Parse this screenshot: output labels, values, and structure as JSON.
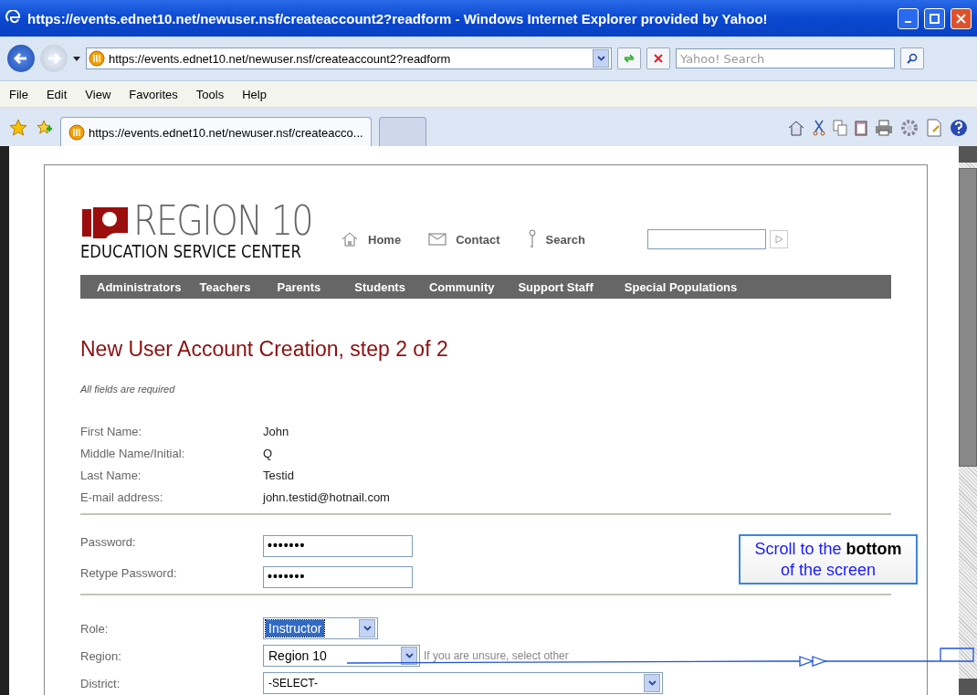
{
  "window": {
    "title": "https://events.ednet10.net/newuser.nsf/createaccount2?readform - Windows Internet Explorer provided by Yahoo!"
  },
  "address_bar": {
    "url": "https://events.ednet10.net/newuser.nsf/createaccount2?readform"
  },
  "search_box": {
    "placeholder": "Yahoo! Search"
  },
  "menu": [
    "File",
    "Edit",
    "View",
    "Favorites",
    "Tools",
    "Help"
  ],
  "tabs": [
    {
      "label": "https://events.ednet10.net/newuser.nsf/createacco...",
      "selected": true
    },
    {
      "selected": false
    }
  ],
  "page": {
    "logo": {
      "title": "REGION 10",
      "subtitle": "EDUCATION SERVICE CENTER"
    },
    "header_links": [
      {
        "label": "Home",
        "kind": "home"
      },
      {
        "label": "Contact",
        "kind": "contact"
      },
      {
        "label": "Search",
        "kind": "search"
      }
    ],
    "nav": [
      "Administrators",
      "Teachers",
      "Parents",
      "Students",
      "Community",
      "Support Staff",
      "Special Populations"
    ],
    "heading": "New User Account Creation, step 2 of 2",
    "note": "All fields are required",
    "profile": [
      {
        "label": "First Name:",
        "value": "John"
      },
      {
        "label": "Middle Name/Initial:",
        "value": "Q"
      },
      {
        "label": "Last Name:",
        "value": "Testid"
      },
      {
        "label": "E-mail address:",
        "value": "john.testid@hotnail.com"
      }
    ],
    "passwords": [
      {
        "label": "Password:",
        "value": "•••••••"
      },
      {
        "label": "Retype Password:",
        "value": "•••••••"
      }
    ],
    "selects": [
      {
        "label": "Role:",
        "value": "Instructor",
        "highlighted": true,
        "kind": "short"
      },
      {
        "label": "Region:",
        "value": "Region 10",
        "highlighted": false,
        "kind": "medium",
        "hint": "If you are unsure, select other"
      },
      {
        "label": "District:",
        "value": "-SELECT-",
        "highlighted": false,
        "kind": "wide"
      }
    ]
  },
  "callout": {
    "text": "Scroll to the **bottom** of the screen"
  }
}
